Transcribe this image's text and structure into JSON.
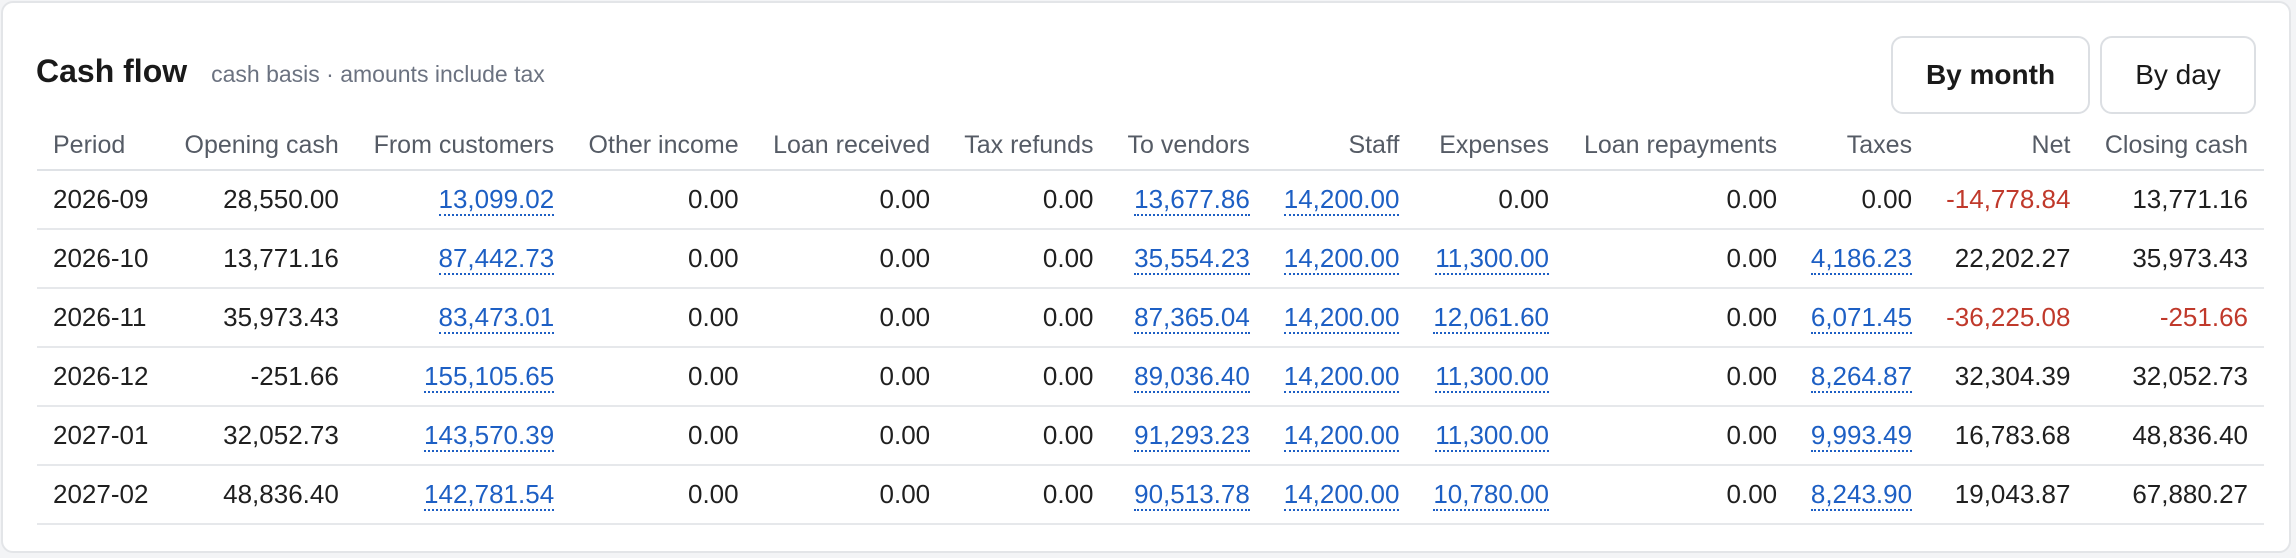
{
  "header": {
    "title": "Cash flow",
    "subtitle": "cash basis · amounts include tax"
  },
  "toggle": {
    "month_label": "By month",
    "day_label": "By day",
    "selected": "By month"
  },
  "colors": {
    "link": "#1d5fc4",
    "negative": "#c0392b"
  },
  "table": {
    "columns": [
      "Period",
      "Opening cash",
      "From customers",
      "Other income",
      "Loan received",
      "Tax refunds",
      "To vendors",
      "Staff",
      "Expenses",
      "Loan repayments",
      "Taxes",
      "Net",
      "Closing cash"
    ],
    "rows": [
      [
        "2026-09",
        "28,550.00",
        "13,099.02",
        "0.00",
        "0.00",
        "0.00",
        "13,677.86",
        "14,200.00",
        "0.00",
        "0.00",
        "0.00",
        "-14,778.84",
        "13,771.16"
      ],
      [
        "2026-10",
        "13,771.16",
        "87,442.73",
        "0.00",
        "0.00",
        "0.00",
        "35,554.23",
        "14,200.00",
        "11,300.00",
        "0.00",
        "4,186.23",
        "22,202.27",
        "35,973.43"
      ],
      [
        "2026-11",
        "35,973.43",
        "83,473.01",
        "0.00",
        "0.00",
        "0.00",
        "87,365.04",
        "14,200.00",
        "12,061.60",
        "0.00",
        "6,071.45",
        "-36,225.08",
        "-251.66"
      ],
      [
        "2026-12",
        "-251.66",
        "155,105.65",
        "0.00",
        "0.00",
        "0.00",
        "89,036.40",
        "14,200.00",
        "11,300.00",
        "0.00",
        "8,264.87",
        "32,304.39",
        "32,052.73"
      ],
      [
        "2027-01",
        "32,052.73",
        "143,570.39",
        "0.00",
        "0.00",
        "0.00",
        "91,293.23",
        "14,200.00",
        "11,300.00",
        "0.00",
        "9,993.49",
        "16,783.68",
        "48,836.40"
      ],
      [
        "2027-02",
        "48,836.40",
        "142,781.54",
        "0.00",
        "0.00",
        "0.00",
        "90,513.78",
        "14,200.00",
        "10,780.00",
        "0.00",
        "8,243.90",
        "19,043.87",
        "67,880.27"
      ]
    ],
    "linked_cells": [
      [
        false,
        false,
        true,
        false,
        false,
        false,
        true,
        true,
        false,
        false,
        false,
        false,
        false
      ],
      [
        false,
        false,
        true,
        false,
        false,
        false,
        true,
        true,
        true,
        false,
        true,
        false,
        false
      ],
      [
        false,
        false,
        true,
        false,
        false,
        false,
        true,
        true,
        true,
        false,
        true,
        false,
        false
      ],
      [
        false,
        false,
        true,
        false,
        false,
        false,
        true,
        true,
        true,
        false,
        true,
        false,
        false
      ],
      [
        false,
        false,
        true,
        false,
        false,
        false,
        true,
        true,
        true,
        false,
        true,
        false,
        false
      ],
      [
        false,
        false,
        true,
        false,
        false,
        false,
        true,
        true,
        true,
        false,
        true,
        false,
        false
      ]
    ],
    "negative_cells": [
      [
        false,
        false,
        false,
        false,
        false,
        false,
        false,
        false,
        false,
        false,
        false,
        true,
        false
      ],
      [
        false,
        false,
        false,
        false,
        false,
        false,
        false,
        false,
        false,
        false,
        false,
        false,
        false
      ],
      [
        false,
        false,
        false,
        false,
        false,
        false,
        false,
        false,
        false,
        false,
        false,
        true,
        true
      ],
      [
        false,
        false,
        false,
        false,
        false,
        false,
        false,
        false,
        false,
        false,
        false,
        false,
        false
      ],
      [
        false,
        false,
        false,
        false,
        false,
        false,
        false,
        false,
        false,
        false,
        false,
        false,
        false
      ],
      [
        false,
        false,
        false,
        false,
        false,
        false,
        false,
        false,
        false,
        false,
        false,
        false,
        false
      ]
    ]
  }
}
